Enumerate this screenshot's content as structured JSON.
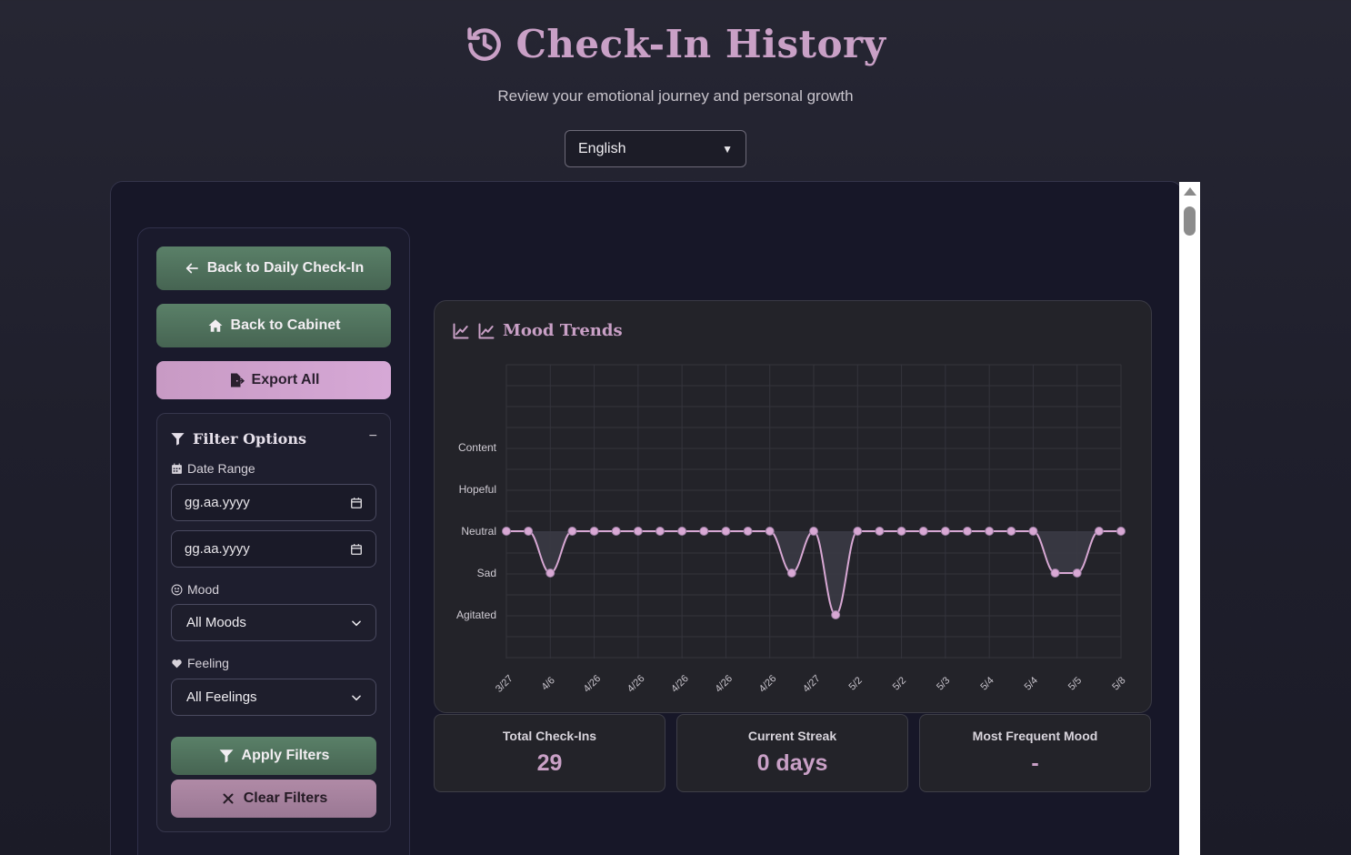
{
  "header": {
    "title": "Check-In History",
    "subtitle": "Review your emotional journey and personal growth"
  },
  "language": {
    "selected": "English"
  },
  "sidebar": {
    "back_daily_label": "Back to Daily Check-In",
    "back_cabinet_label": "Back to Cabinet",
    "export_label": "Export All"
  },
  "filters": {
    "title": "Filter Options",
    "collapse_symbol": "−",
    "date_range_label": "Date Range",
    "date_from_placeholder": "gg.aa.yyyy",
    "date_to_placeholder": "gg.aa.yyyy",
    "mood_label": "Mood",
    "mood_selected": "All Moods",
    "feeling_label": "Feeling",
    "feeling_selected": "All Feelings",
    "apply_label": "Apply Filters",
    "clear_label": "Clear Filters"
  },
  "chart_title": "Mood Trends",
  "chart_data": {
    "type": "line",
    "title": "Mood Trends",
    "y_categories": [
      "Agitated",
      "Sad",
      "Neutral",
      "Hopeful",
      "Content"
    ],
    "x_tick_labels": [
      "3/27",
      "4/6",
      "4/26",
      "4/26",
      "4/26",
      "4/26",
      "4/26",
      "4/27",
      "5/2",
      "5/2",
      "5/3",
      "5/4",
      "5/4",
      "5/5",
      "5/8"
    ],
    "series": [
      {
        "values": [
          "Neutral",
          "Neutral",
          "Sad",
          "Neutral",
          "Neutral",
          "Neutral",
          "Neutral",
          "Neutral",
          "Neutral",
          "Neutral",
          "Neutral",
          "Neutral",
          "Neutral",
          "Sad",
          "Neutral",
          "Agitated",
          "Neutral",
          "Neutral",
          "Neutral",
          "Neutral",
          "Neutral",
          "Neutral",
          "Neutral",
          "Neutral",
          "Neutral",
          "Sad",
          "Sad",
          "Neutral",
          "Neutral"
        ]
      }
    ],
    "grid": true,
    "line_color": "#d8a8d4",
    "fill_color": "#3a3a44"
  },
  "stats": [
    {
      "label": "Total Check-Ins",
      "value": "29"
    },
    {
      "label": "Current Streak",
      "value": "0 days"
    },
    {
      "label": "Most Frequent Mood",
      "value": "-"
    }
  ]
}
